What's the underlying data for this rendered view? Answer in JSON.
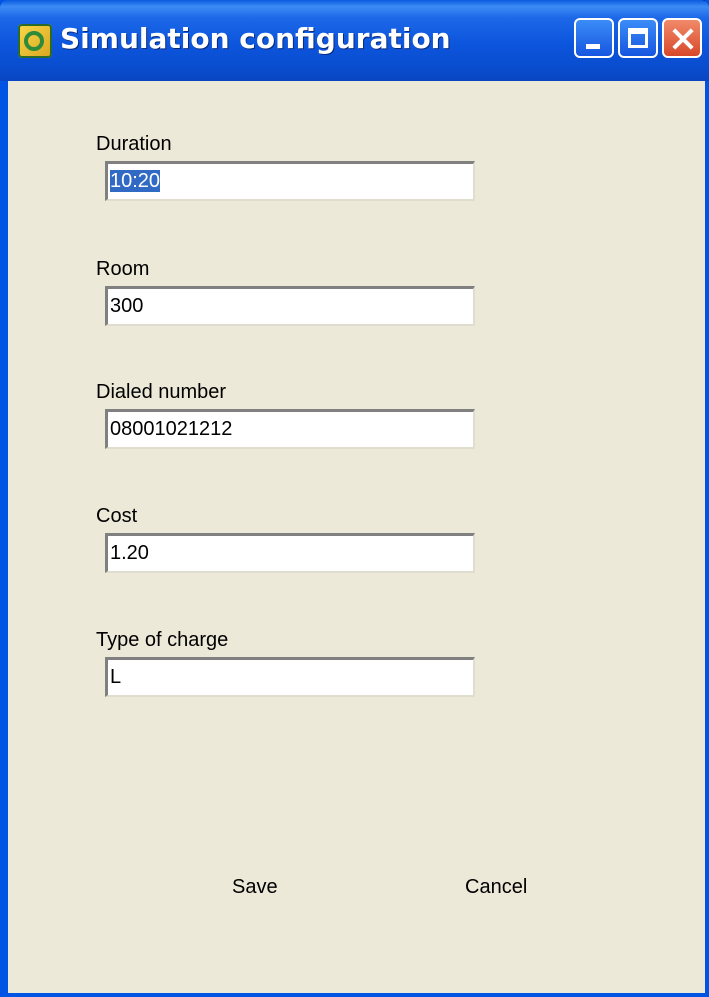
{
  "window": {
    "title": "Simulation configuration",
    "icon": "app-icon"
  },
  "form": {
    "fields": [
      {
        "label": "Duration",
        "value": "10:20"
      },
      {
        "label": "Room",
        "value": "300"
      },
      {
        "label": "Dialed number",
        "value": "08001021212"
      },
      {
        "label": "Cost",
        "value": "1.20"
      },
      {
        "label": "Type of charge",
        "value": "L"
      }
    ]
  },
  "buttons": {
    "save_label": "Save",
    "cancel_label": "Cancel"
  }
}
